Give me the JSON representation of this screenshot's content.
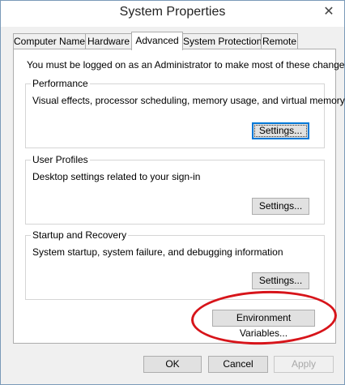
{
  "window": {
    "title": "System Properties",
    "close_glyph": "✕"
  },
  "tabs": [
    {
      "label": "Computer Name"
    },
    {
      "label": "Hardware"
    },
    {
      "label": "Advanced"
    },
    {
      "label": "System Protection"
    },
    {
      "label": "Remote"
    }
  ],
  "advanced": {
    "admin_note": "You must be logged on as an Administrator to make most of these changes.",
    "performance": {
      "label": "Performance",
      "description": "Visual effects, processor scheduling, memory usage, and virtual memory",
      "button": "Settings..."
    },
    "user_profiles": {
      "label": "User Profiles",
      "description": "Desktop settings related to your sign-in",
      "button": "Settings..."
    },
    "startup_recovery": {
      "label": "Startup and Recovery",
      "description": "System startup, system failure, and debugging information",
      "button": "Settings..."
    },
    "env_button": "Environment Variables..."
  },
  "footer": {
    "ok": "OK",
    "cancel": "Cancel",
    "apply": "Apply"
  },
  "colors": {
    "annotation_ellipse": "#d7141a",
    "focus_border": "#0078d7"
  }
}
